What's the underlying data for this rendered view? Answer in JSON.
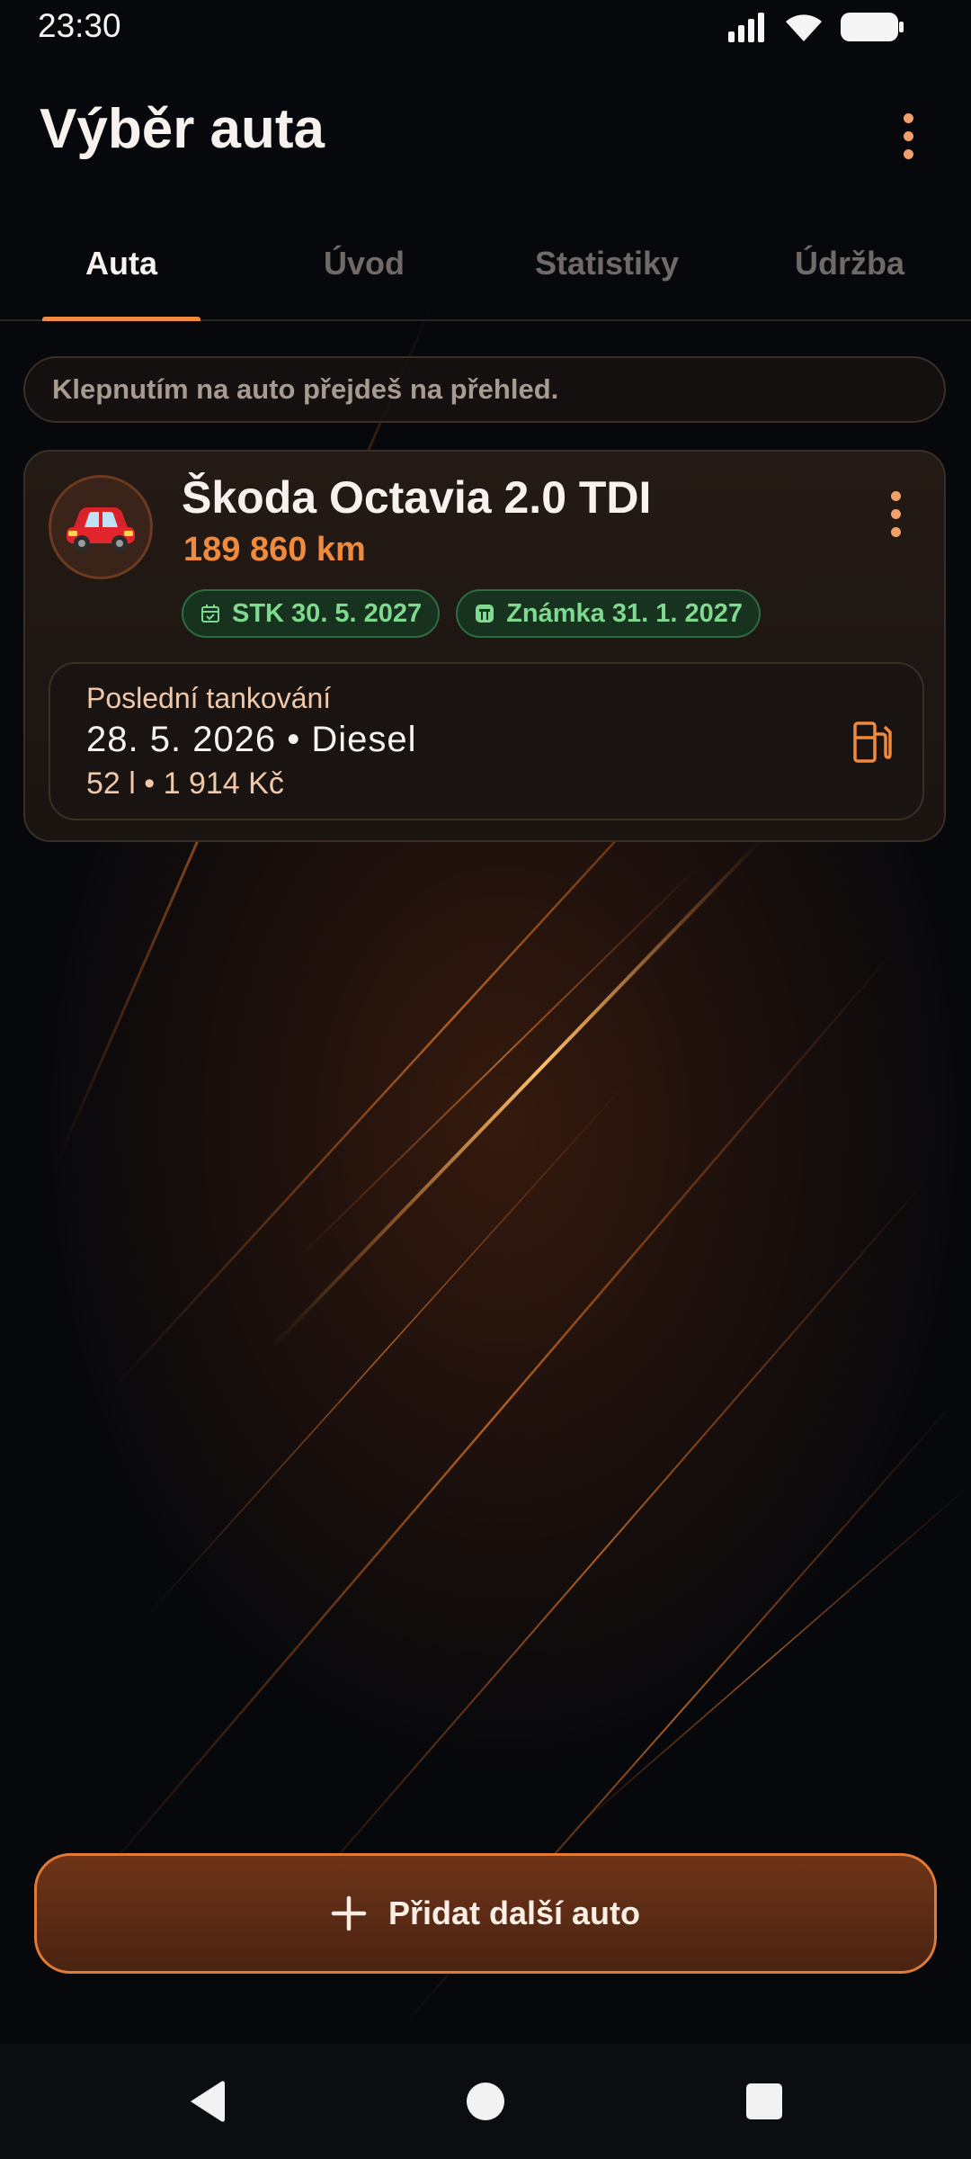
{
  "status": {
    "time": "23:30"
  },
  "app_bar": {
    "title": "Výběr auta"
  },
  "tabs": [
    {
      "label": "Auta",
      "active": true
    },
    {
      "label": "Úvod",
      "active": false
    },
    {
      "label": "Statistiky",
      "active": false
    },
    {
      "label": "Údržba",
      "active": false
    }
  ],
  "hint": "Klepnutím na auto přejdeš na přehled.",
  "car": {
    "icon": "car-icon",
    "name": "Škoda Octavia 2.0 TDI",
    "odometer": "189 860 km",
    "stk_label": "STK 30. 5. 2027",
    "vignette_label": "Známka 31. 1. 2027",
    "last_fuel": {
      "title": "Poslední tankování",
      "main": "28. 5. 2026 • Diesel",
      "sub": "52 l • 1 914 Kč",
      "icon": "fuel-pump-icon"
    }
  },
  "add_button": {
    "label": "Přidat další auto",
    "icon": "plus-icon"
  },
  "colors": {
    "accent": "#f08a3c",
    "background": "#07080c",
    "chip_green": "#7fd98f"
  }
}
